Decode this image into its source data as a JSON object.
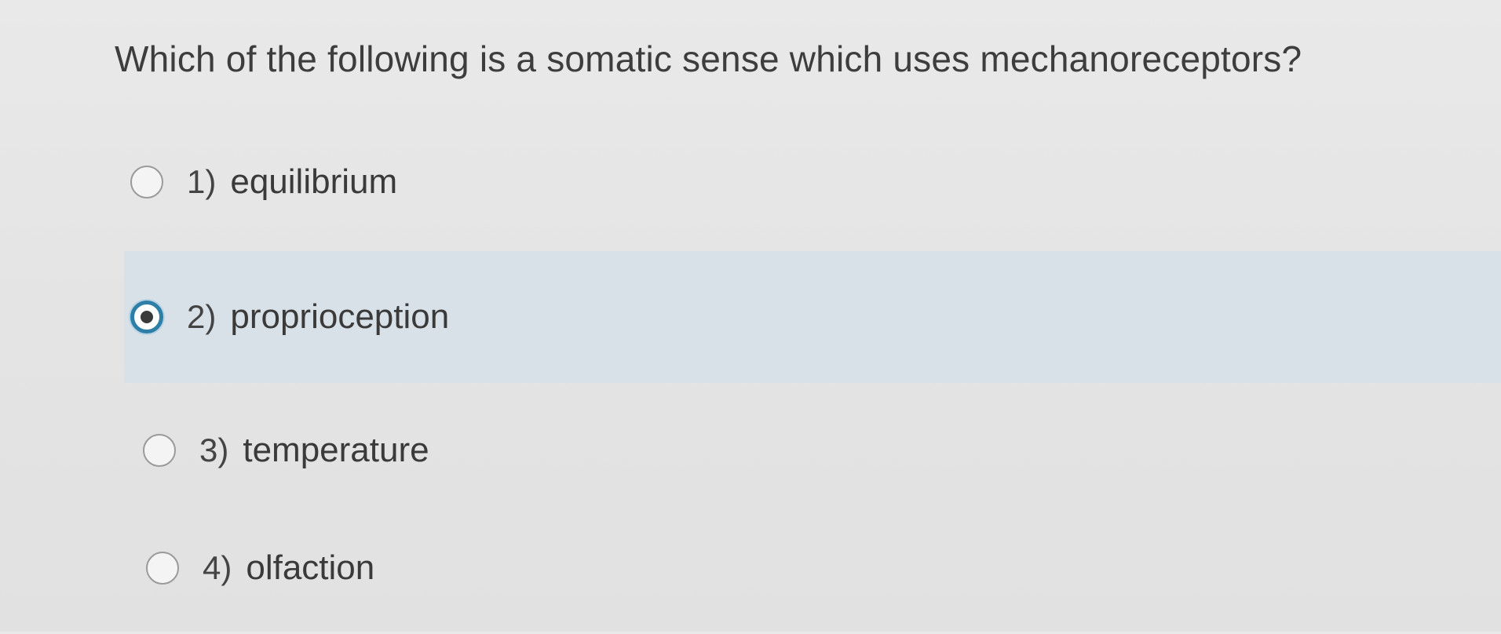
{
  "question": {
    "text": "Which of the following is a somatic sense which uses mechanoreceptors?"
  },
  "options": [
    {
      "number": "1)",
      "label": "equilibrium",
      "selected": false
    },
    {
      "number": "2)",
      "label": "proprioception",
      "selected": true
    },
    {
      "number": "3)",
      "label": "temperature",
      "selected": false
    },
    {
      "number": "4)",
      "label": "olfaction",
      "selected": false
    }
  ],
  "colors": {
    "background": "#e6e6e6",
    "selected_row": "#d8e1e7",
    "radio_accent": "#2e7fa8",
    "text": "#3a3a3a"
  }
}
